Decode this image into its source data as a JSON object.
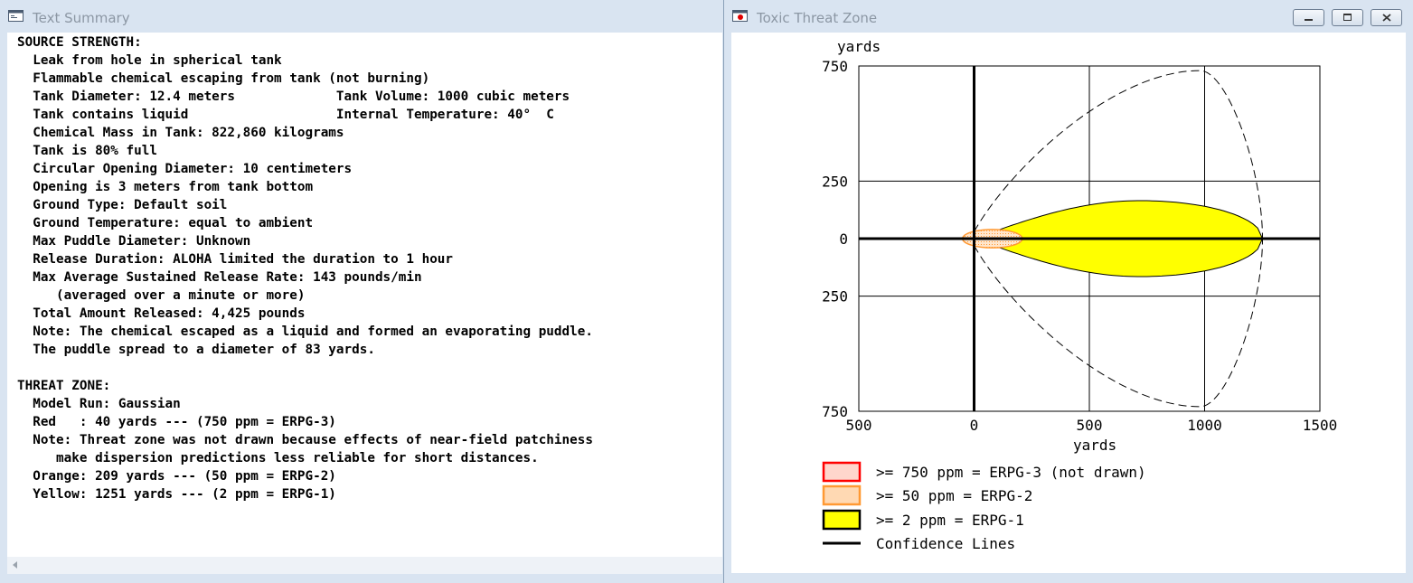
{
  "summary_window": {
    "title": "Text Summary",
    "lines": [
      "SOURCE STRENGTH:",
      "  Leak from hole in spherical tank",
      "  Flammable chemical escaping from tank (not burning)",
      "  Tank Diameter: 12.4 meters             Tank Volume: 1000 cubic meters",
      "  Tank contains liquid                   Internal Temperature: 40°  C",
      "  Chemical Mass in Tank: 822,860 kilograms",
      "  Tank is 80% full",
      "  Circular Opening Diameter: 10 centimeters",
      "  Opening is 3 meters from tank bottom",
      "  Ground Type: Default soil",
      "  Ground Temperature: equal to ambient",
      "  Max Puddle Diameter: Unknown",
      "  Release Duration: ALOHA limited the duration to 1 hour",
      "  Max Average Sustained Release Rate: 143 pounds/min",
      "     (averaged over a minute or more)",
      "  Total Amount Released: 4,425 pounds",
      "  Note: The chemical escaped as a liquid and formed an evaporating puddle.",
      "  The puddle spread to a diameter of 83 yards.",
      "",
      "THREAT ZONE:",
      "  Model Run: Gaussian",
      "  Red   : 40 yards --- (750 ppm = ERPG-3)",
      "  Note: Threat zone was not drawn because effects of near-field patchiness",
      "     make dispersion predictions less reliable for short distances.",
      "  Orange: 209 yards --- (50 ppm = ERPG-2)",
      "  Yellow: 1251 yards --- (2 ppm = ERPG-1)"
    ]
  },
  "zone_window": {
    "title": "Toxic Threat Zone",
    "buttons": {
      "minimize": "minimize",
      "restore": "restore",
      "close": "close"
    }
  },
  "chart_data": {
    "type": "area",
    "ylabel": "yards",
    "xlabel": "yards",
    "x_ticks": [
      "500",
      "0",
      "500",
      "1000",
      "1500"
    ],
    "y_ticks": [
      "750",
      "250",
      "0",
      "250",
      "750"
    ],
    "xlim": [
      -500,
      1500
    ],
    "ylim": [
      -750,
      750
    ],
    "zones": [
      {
        "name": "Red",
        "distance_yards": 40,
        "drawn": false
      },
      {
        "name": "Orange",
        "distance_yards": 209,
        "half_width_yards": 40,
        "color": "#ff9933"
      },
      {
        "name": "Yellow",
        "distance_yards": 1251,
        "half_width_yards": 165,
        "peak_x_yards": 720,
        "color": "#ffff00"
      }
    ],
    "confidence_lines": {
      "max_half_width_yards": 730,
      "max_half_width_x_yards": 980,
      "end_x_yards": 1251
    },
    "legend": [
      {
        "label": ">= 750 ppm = ERPG-3 (not drawn)",
        "border": "#ff0000",
        "fill": "#ffd6cc"
      },
      {
        "label": ">= 50 ppm = ERPG-2",
        "border": "#ff9933",
        "fill": "#ffd9b3"
      },
      {
        "label": ">= 2 ppm = ERPG-1",
        "border": "#000000",
        "fill": "#ffff00"
      },
      {
        "label": "Confidence Lines",
        "line": true
      }
    ]
  }
}
